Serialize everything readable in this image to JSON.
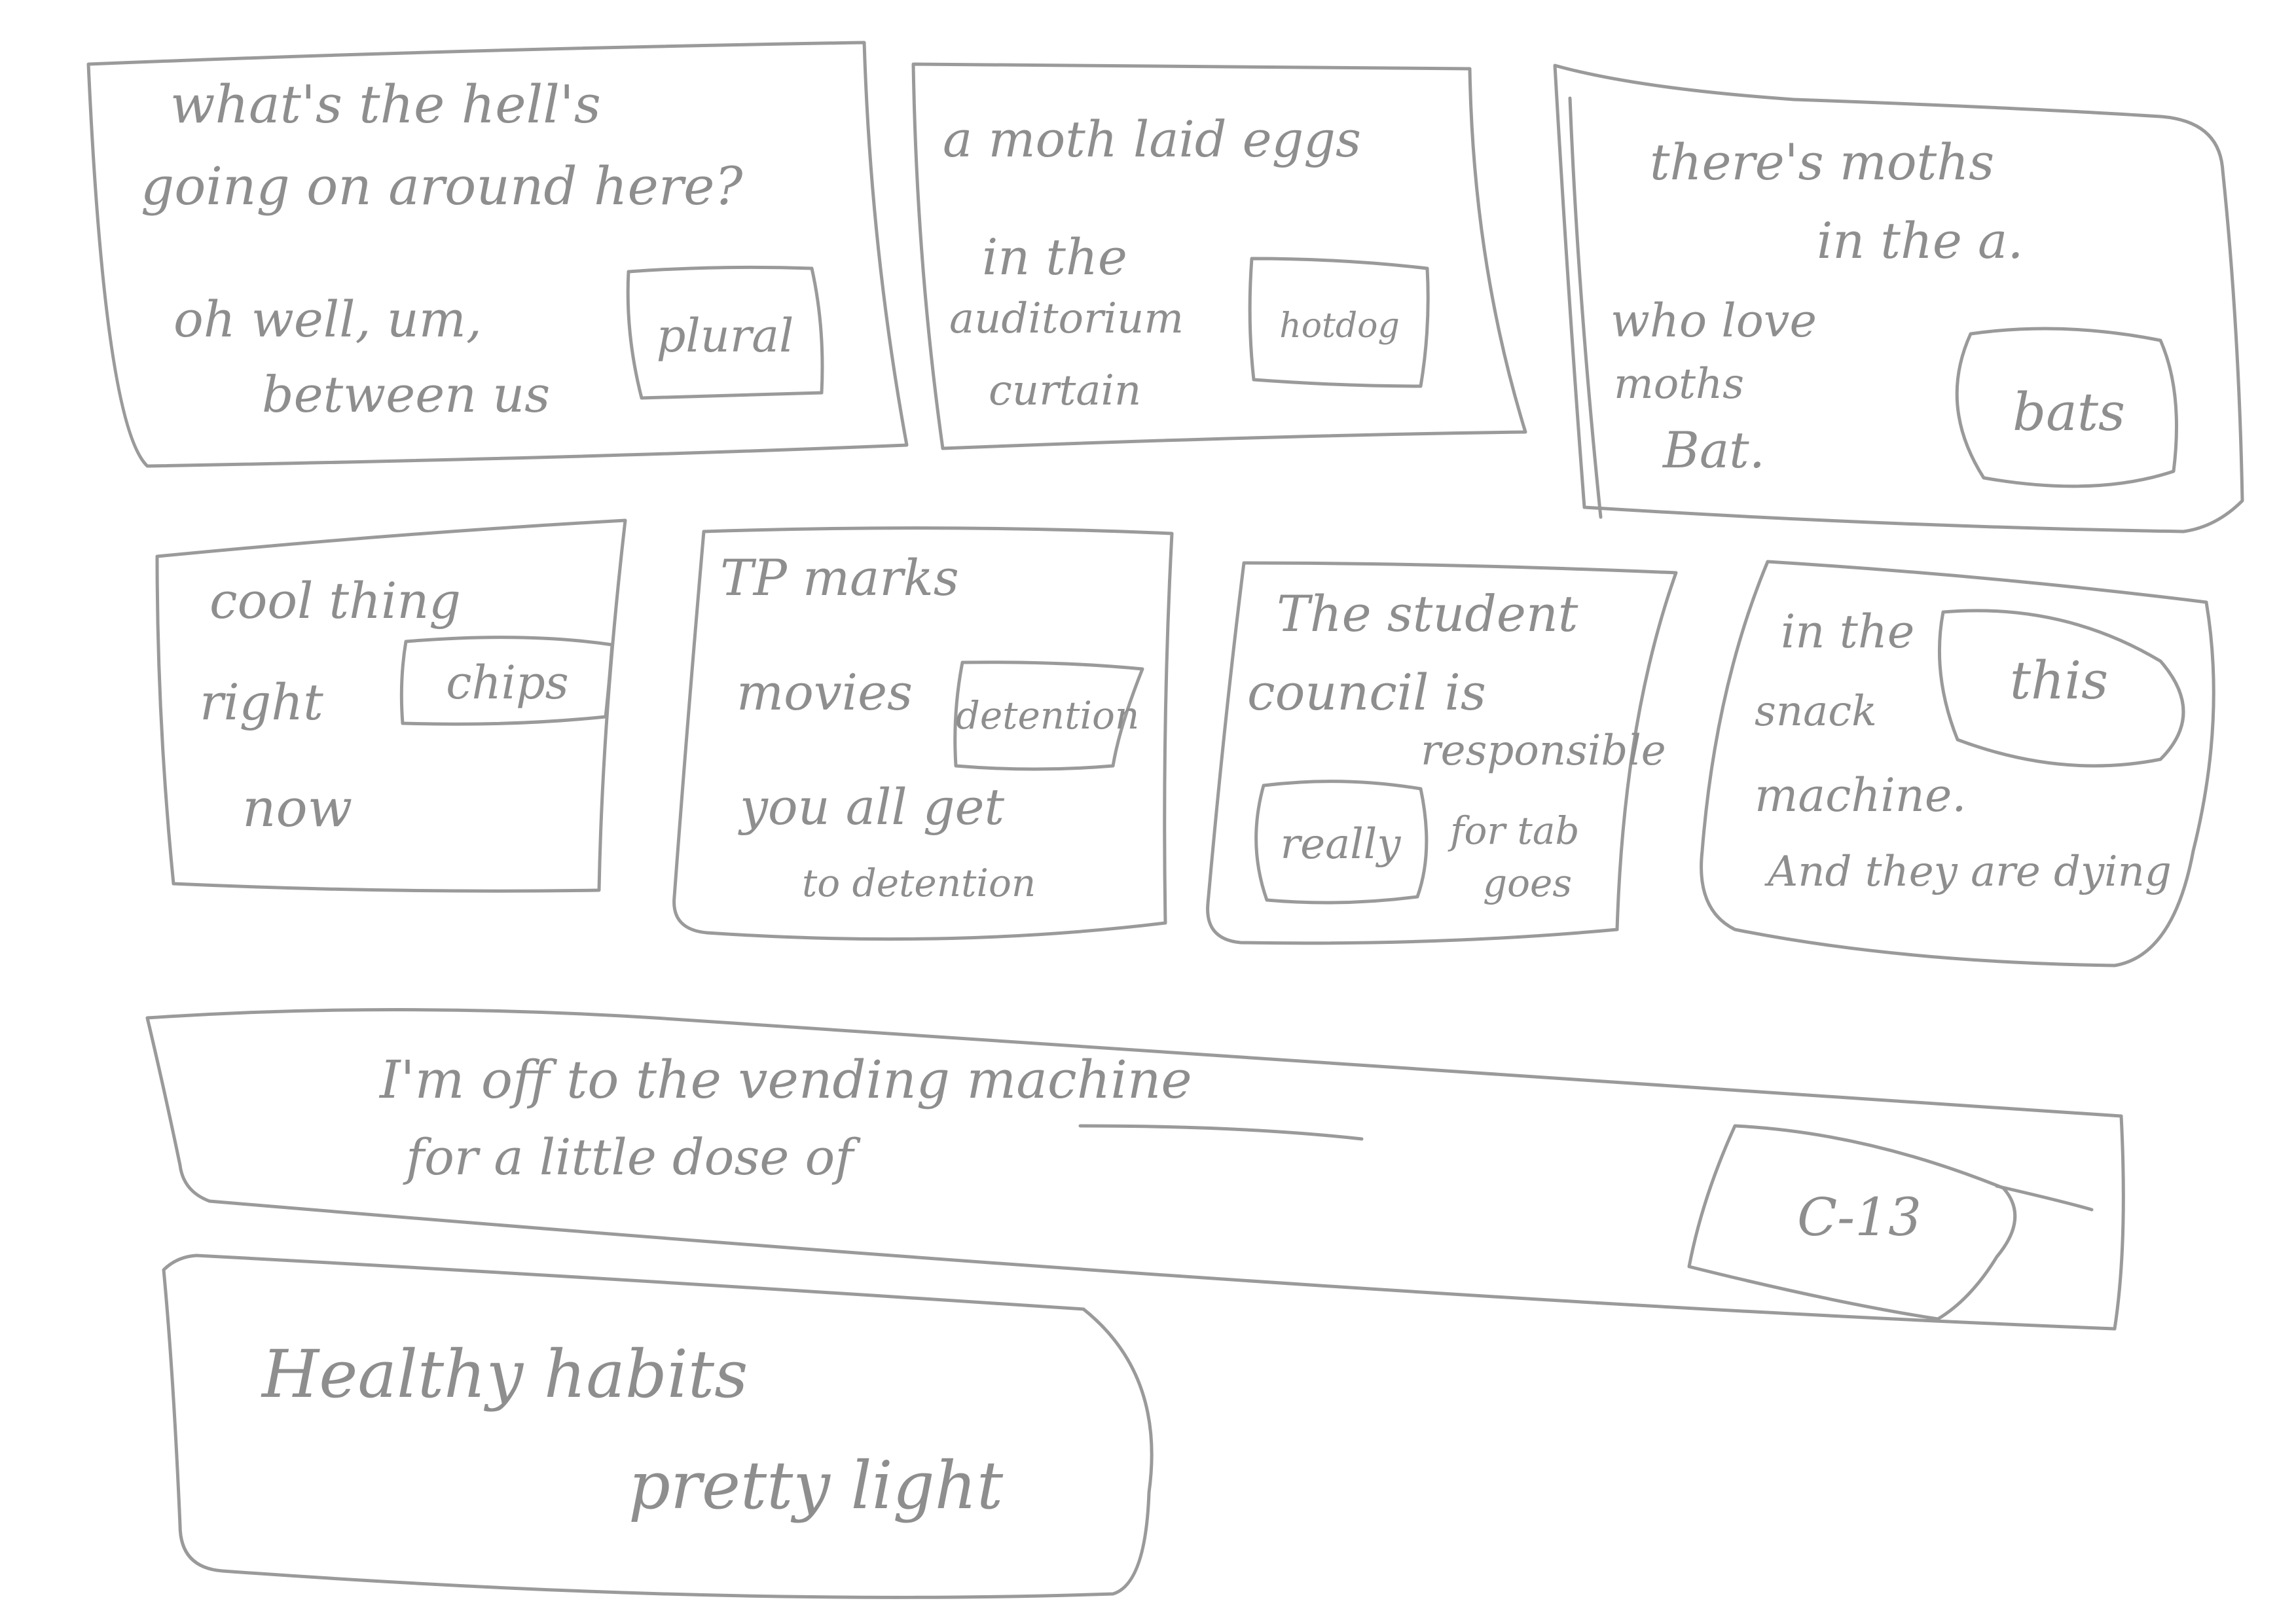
{
  "panels": [
    {
      "lines": [
        "what's the hell's",
        "going on around here?",
        "oh well, um,",
        "between us"
      ],
      "tag": "plural"
    },
    {
      "lines": [
        "a moth laid eggs",
        "in the",
        "auditorium",
        "curtain"
      ],
      "tag": "hotdog"
    },
    {
      "lines": [
        "there's moths",
        "in the a.",
        "who love",
        "moths",
        "Bat."
      ],
      "tag": "bats"
    },
    {
      "lines": [
        "cool thing",
        "right",
        "now"
      ],
      "tag": "chips"
    },
    {
      "lines": [
        "TP marks",
        "movies",
        "you all get",
        "to detention"
      ],
      "tag": "detention"
    },
    {
      "lines": [
        "The student",
        "council is",
        "responsible",
        "for tab",
        "goes"
      ],
      "tag": "really"
    },
    {
      "lines": [
        "in the",
        "snack",
        "machine.",
        "And they are dying"
      ],
      "tag": "this"
    },
    {
      "lines": [
        "I'm off to the vending machine",
        "for a little dose of"
      ],
      "tag": "C-13"
    },
    {
      "lines": [
        "Healthy habits",
        "pretty light"
      ],
      "tag": ""
    }
  ]
}
